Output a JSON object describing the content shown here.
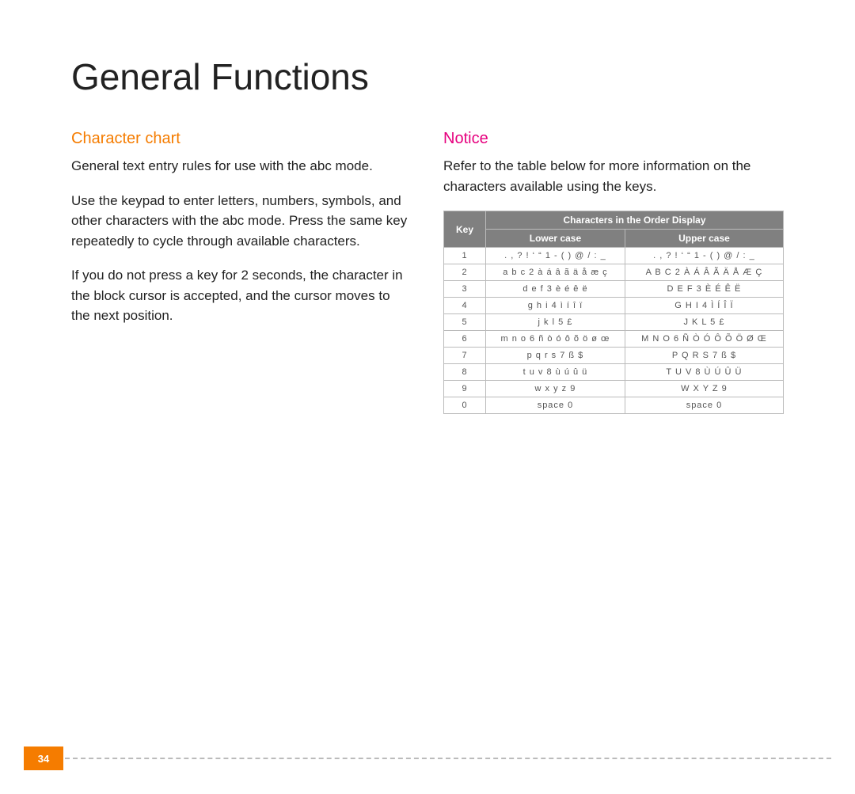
{
  "page_title": "General Functions",
  "page_number": "34",
  "left": {
    "heading": "Character chart",
    "p1": "General text entry rules for use with the abc mode.",
    "p2": "Use the keypad to enter letters, numbers, symbols, and other characters with the abc mode. Press the same key repeatedly to cycle through available characters.",
    "p3": "If you do not press a key for 2 seconds, the character in the block cursor is accepted, and the cursor moves to the next position."
  },
  "right": {
    "heading": "Notice",
    "p1": "Refer to the table below for more information on the characters available using the keys.",
    "table": {
      "header_key": "Key",
      "header_order": "Characters in the Order Display",
      "header_lower": "Lower case",
      "header_upper": "Upper case",
      "rows": [
        {
          "key": "1",
          "lower": ". , ? ! ‘ “ 1 - ( ) @ / : _",
          "upper": ". , ? ! ‘ “ 1 - ( ) @ / : _"
        },
        {
          "key": "2",
          "lower": "a b c 2 à á â ã ä å æ ç",
          "upper": "A B C 2 À Á Â Ã Ä Å Æ Ç"
        },
        {
          "key": "3",
          "lower": "d e f 3 è é ê ë",
          "upper": "D E F 3 È É Ê Ë"
        },
        {
          "key": "4",
          "lower": "g h i 4 ì í î ï",
          "upper": "G H I 4 Ì Í Î Ï"
        },
        {
          "key": "5",
          "lower": "j k l 5 £",
          "upper": "J K L 5 £"
        },
        {
          "key": "6",
          "lower": "m n o 6 ñ ò ó ô õ ö ø œ",
          "upper": "M N O 6 Ñ Ò Ó Ô Õ Ö Ø Œ"
        },
        {
          "key": "7",
          "lower": "p q r s 7 ß $",
          "upper": "P Q R S 7 ß $"
        },
        {
          "key": "8",
          "lower": "t u v 8 ù ú û ü",
          "upper": "T U V 8 Ù Ú Û Ü"
        },
        {
          "key": "9",
          "lower": "w x y z 9",
          "upper": "W X Y Z 9"
        },
        {
          "key": "0",
          "lower": "space 0",
          "upper": "space 0"
        }
      ]
    }
  }
}
